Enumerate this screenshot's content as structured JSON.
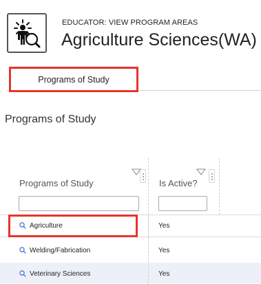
{
  "header": {
    "kicker": "EDUCATOR: VIEW PROGRAM AREAS",
    "title": "Agriculture Sciences(WA)",
    "logo_icon": "educator-search-icon"
  },
  "tabs": [
    {
      "label": "Programs of Study",
      "selected": true
    }
  ],
  "section_title": "Programs of Study",
  "grid": {
    "columns": [
      {
        "label": "Programs of Study",
        "filter_value": ""
      },
      {
        "label": "Is Active?",
        "filter_value": ""
      }
    ],
    "rows": [
      {
        "program": "Agriculture",
        "active": "Yes",
        "highlighted": true
      },
      {
        "program": "Welding/Fabrication",
        "active": "Yes",
        "highlighted": false
      },
      {
        "program": "Veterinary Sciences",
        "active": "Yes",
        "highlighted": false
      }
    ]
  },
  "colors": {
    "accent_red": "#e8332a",
    "link_blue": "#3b6fd8",
    "alt_row": "#eef0f9"
  }
}
